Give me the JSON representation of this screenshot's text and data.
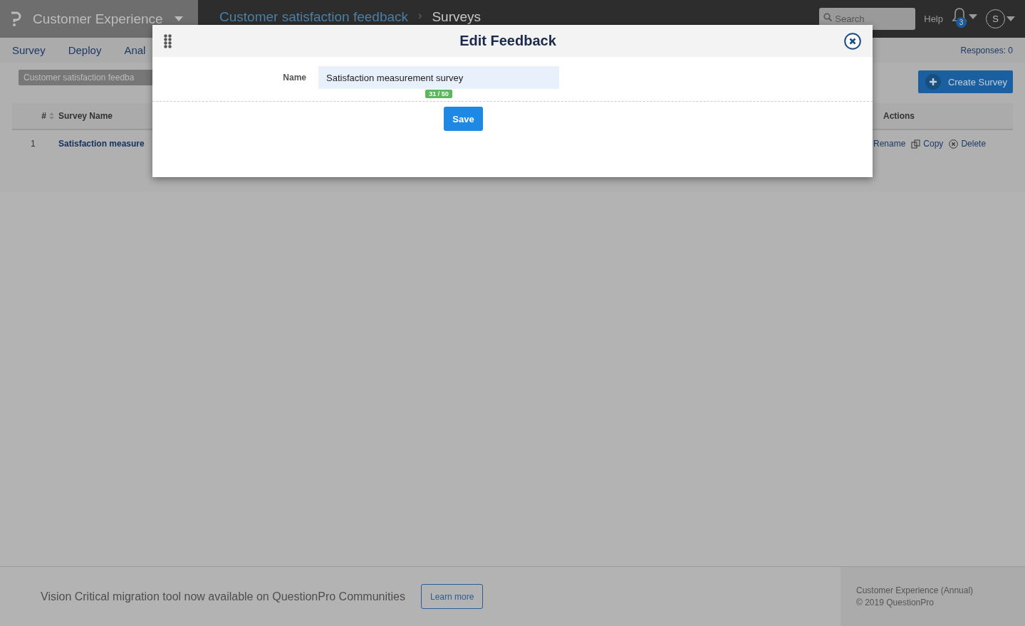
{
  "topbar": {
    "brand": "Customer Experience",
    "breadcrumb": [
      {
        "label": "Customer satisfaction feedback",
        "kind": "link"
      },
      {
        "label": "Surveys",
        "kind": "current"
      }
    ],
    "breadcrumb_separator": "›",
    "search": {
      "placeholder": "Search"
    },
    "help": "Help",
    "notifications": "3",
    "avatar": "S"
  },
  "nav": {
    "tabs": [
      "Survey",
      "Deploy",
      "Anal"
    ],
    "responses": "Responses: 0"
  },
  "folder": "Customer satisfaction feedba",
  "create_button": "Create Survey",
  "table": {
    "columns": [
      "#",
      "Survey Name",
      "Actions"
    ],
    "rows": [
      {
        "number": "1",
        "name": "Satisfaction measure",
        "actions": [
          {
            "label": "Rename",
            "kind": "rename"
          },
          {
            "label": "Copy",
            "kind": "copy"
          },
          {
            "label": "Delete",
            "kind": "delete"
          }
        ]
      }
    ]
  },
  "modal": {
    "title": "Edit Feedback",
    "field_label": "Name",
    "value": "Satisfaction measurement survey",
    "counter": "31 / 50",
    "save": "Save"
  },
  "footer": {
    "message": "Vision Critical migration tool now available on QuestionPro Communities",
    "button": "Learn more",
    "plan": "Customer Experience (Annual)",
    "copyright": "© 2019 QuestionPro"
  }
}
